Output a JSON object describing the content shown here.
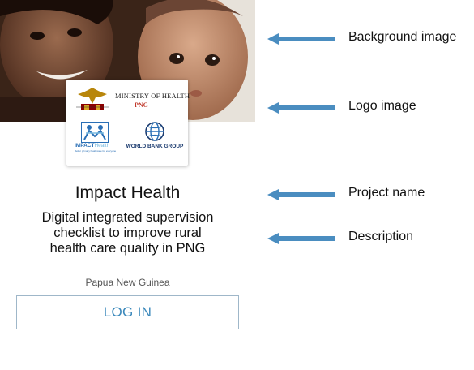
{
  "card": {
    "project_name": "Impact Health",
    "description_lines": [
      "Digital integrated supervision",
      "checklist to improve rural",
      "health care quality in PNG"
    ],
    "location": "Papua New Guinea",
    "login_label": "LOG IN"
  },
  "logos": {
    "ministry_title": "MINISTRY OF HEALTH",
    "ministry_subtitle": "PNG",
    "impact_name_main": "IMPACT",
    "impact_name_accent": "Health",
    "impact_tagline": "Better primary healthcare for everyone",
    "worldbank_name": "WORLD BANK GROUP"
  },
  "annotations": [
    {
      "label": "Background image"
    },
    {
      "label": "Logo image"
    },
    {
      "label": "Project name"
    },
    {
      "label": "Description"
    }
  ],
  "colors": {
    "accent": "#3a88bb",
    "arrow": "#4a8dc0",
    "button_border": "#9fb7c9",
    "ministry_red": "#c0392b",
    "worldbank_navy": "#1b3b6f"
  },
  "icons": {
    "ministry_emblem": "png-emblem-icon",
    "impact_logo": "impact-health-people-icon",
    "worldbank_logo": "globe-icon",
    "annotation_arrow": "arrow-left-icon"
  }
}
